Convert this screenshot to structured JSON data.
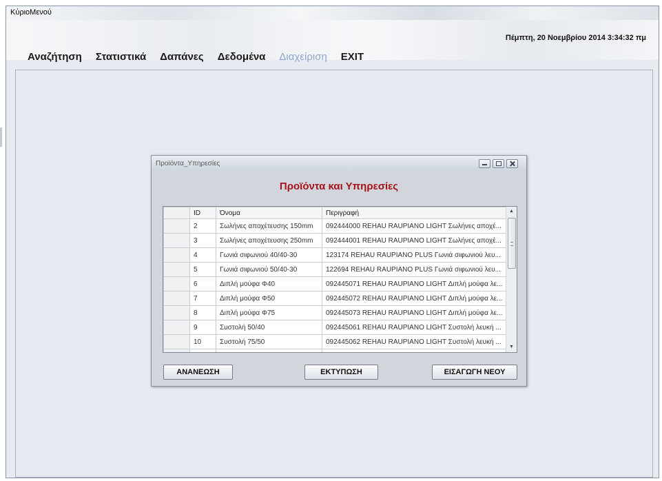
{
  "window": {
    "title": "ΚύριοΜενού"
  },
  "header": {
    "datetime": "Πέμπτη, 20 Νοεμβρίου 2014 3:34:32 πμ"
  },
  "menu": {
    "items": [
      {
        "label": "Αναζήτηση",
        "enabled": true
      },
      {
        "label": "Στατιστικά",
        "enabled": true
      },
      {
        "label": "Δαπάνες",
        "enabled": true
      },
      {
        "label": "Δεδομένα",
        "enabled": true
      },
      {
        "label": "Διαχείριση",
        "enabled": false
      },
      {
        "label": "EXIT",
        "enabled": true
      }
    ]
  },
  "child_window": {
    "title": "Προϊόντα_Υπηρεσίες",
    "heading": "Προϊόντα και Υπηρεσίες",
    "heading_color": "#a5121a"
  },
  "grid": {
    "columns": [
      "ID",
      "Όνομα",
      "Περιγραφή"
    ],
    "rows": [
      {
        "id": "2",
        "name": "Σωλήνες αποχέτευσης 150mm",
        "desc": "092444000 REHAU RAUPIANO LIGHT Σωλήνες αποχέ..."
      },
      {
        "id": "3",
        "name": "Σωλήνες αποχέτευσης 250mm",
        "desc": "092444001 REHAU RAUPIANO LIGHT Σωλήνες αποχέ..."
      },
      {
        "id": "4",
        "name": "Γωνιά σιφωνιού 40/40-30",
        "desc": "123174 REHAU RAUPIANO PLUS Γωνιά σιφωνιού λευ..."
      },
      {
        "id": "5",
        "name": "Γωνιά σιφωνιού 50/40-30",
        "desc": "122694 REHAU RAUPIANO PLUS Γωνιά σιφωνιού λευ..."
      },
      {
        "id": "6",
        "name": "Διπλή μούφα Φ40",
        "desc": "092445071 REHAU RAUPIANO LIGHT Διπλή μούφα λε..."
      },
      {
        "id": "7",
        "name": "Διπλή μούφα Φ50",
        "desc": "092445072 REHAU RAUPIANO LIGHT Διπλή μούφα λε..."
      },
      {
        "id": "8",
        "name": "Διπλή μούφα Φ75",
        "desc": "092445073 REHAU RAUPIANO LIGHT Διπλή μούφα λε..."
      },
      {
        "id": "9",
        "name": "Συστολή 50/40",
        "desc": "092445061 REHAU RAUPIANO LIGHT Συστολή λευκή ..."
      },
      {
        "id": "10",
        "name": "Συστολή 75/50",
        "desc": "092445062 REHAU RAUPIANO LIGHT Συστολή λευκή ..."
      }
    ]
  },
  "buttons": {
    "refresh": "ΑΝΑΝΕΩΣΗ",
    "print": "ΕΚΤΥΠΩΣΗ",
    "new": "ΕΙΣΑΓΩΓΗ ΝΕΟΥ"
  },
  "icons": {
    "minimize": "minimize-icon",
    "maximize": "maximize-icon",
    "close": "close-icon",
    "scroll_up": "scroll-up-arrow-icon",
    "scroll_down": "scroll-down-arrow-icon"
  }
}
